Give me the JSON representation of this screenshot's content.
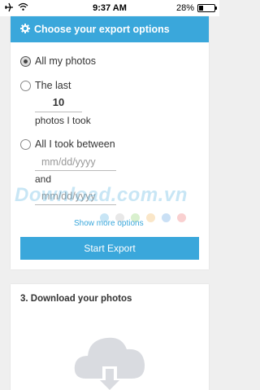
{
  "status_bar": {
    "time": "9:37 AM",
    "battery": "28%"
  },
  "export": {
    "title": "Choose your export options",
    "options": [
      {
        "label": "All my photos",
        "checked": true
      },
      {
        "label": "The last",
        "checked": false
      },
      {
        "label": "All I took between",
        "checked": false
      }
    ],
    "last_count": "10",
    "last_suffix": "photos I took",
    "date_from_placeholder": "mm/dd/yyyy",
    "and_label": "and",
    "date_to_placeholder": "mm/dd/yyyy",
    "show_more": "Show more options",
    "start_button": "Start Export"
  },
  "download": {
    "title": "3. Download your photos"
  },
  "watermark": {
    "text": "Download.com.vn",
    "dot_colors": [
      "#9ad0ec",
      "#d6d6d6",
      "#b9e3a5",
      "#f6d19a",
      "#9fc6ec",
      "#f4a9a9"
    ]
  },
  "colors": {
    "accent": "#3aa7db",
    "background": "#efefef"
  }
}
